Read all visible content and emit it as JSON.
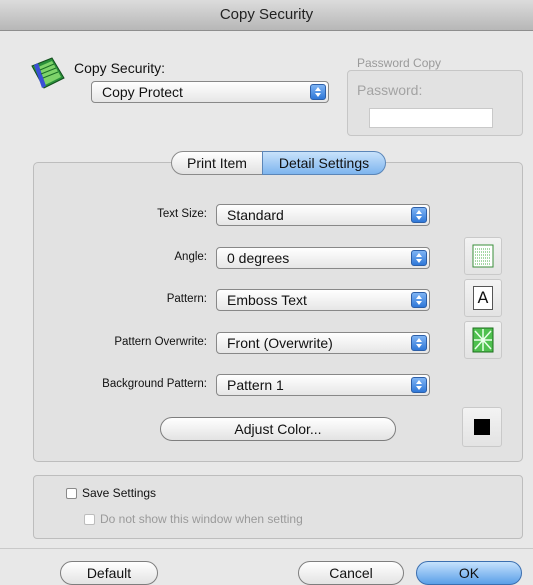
{
  "window": {
    "title": "Copy Security"
  },
  "copy_security": {
    "label": "Copy Security:",
    "selected": "Copy Protect"
  },
  "password_copy": {
    "group_label": "Password Copy",
    "password_label": "Password:",
    "password_value": ""
  },
  "tabs": [
    {
      "label": "Print Item",
      "selected": false
    },
    {
      "label": "Detail Settings",
      "selected": true
    }
  ],
  "detail": {
    "text_size": {
      "label": "Text Size:",
      "value": "Standard"
    },
    "angle": {
      "label": "Angle:",
      "value": "0 degrees"
    },
    "pattern": {
      "label": "Pattern:",
      "value": "Emboss Text"
    },
    "pattern_overwrite": {
      "label": "Pattern Overwrite:",
      "value": "Front (Overwrite)"
    },
    "background_pattern": {
      "label": "Background Pattern:",
      "value": "Pattern 1"
    },
    "adjust_color_label": "Adjust Color...",
    "pattern_glyph": "A"
  },
  "save": {
    "save_settings_label": "Save Settings",
    "save_settings_checked": false,
    "do_not_show_label": "Do not show this window when setting",
    "do_not_show_checked": false
  },
  "buttons": {
    "default": "Default",
    "cancel": "Cancel",
    "ok": "OK"
  },
  "colors": {
    "selected_color": "#000000",
    "accent": "#5a9fe8"
  }
}
